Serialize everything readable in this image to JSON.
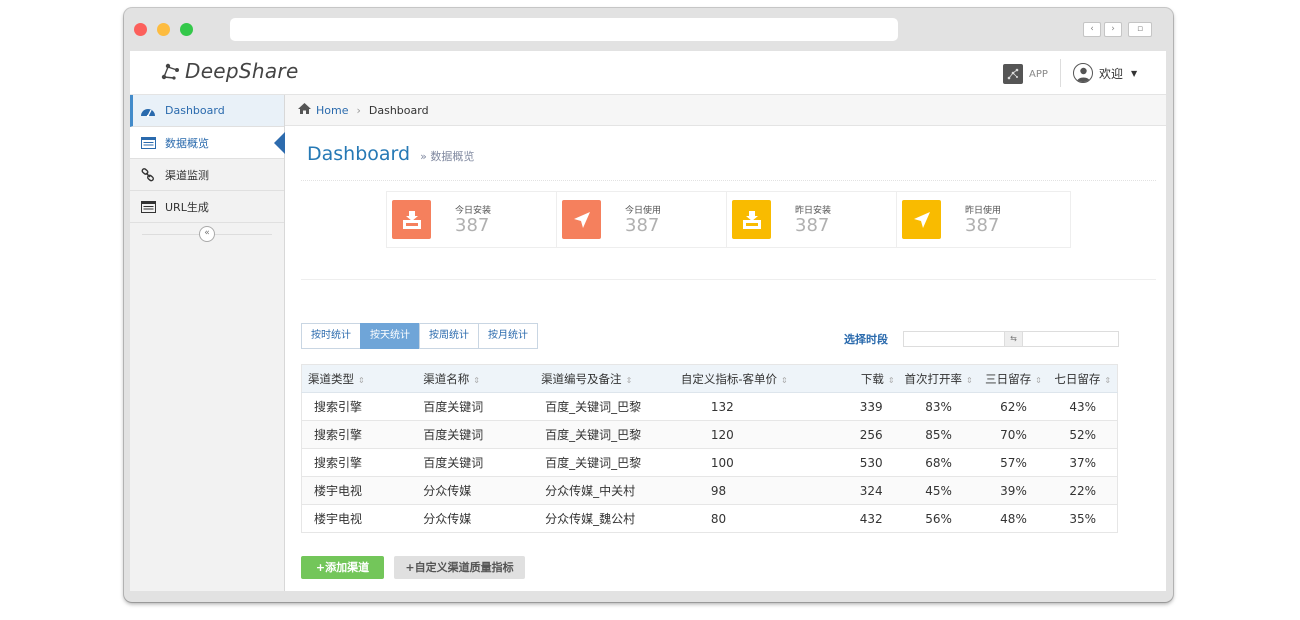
{
  "brand": {
    "name": "DeepShare"
  },
  "header": {
    "app_label": "APP",
    "welcome": "欢迎"
  },
  "sidebar": {
    "items": [
      {
        "label": "Dashboard",
        "icon": "dashboard-icon"
      },
      {
        "label": "数据概览",
        "icon": "list-icon"
      },
      {
        "label": "渠道监测",
        "icon": "link-icon"
      },
      {
        "label": "URL生成",
        "icon": "list-icon"
      }
    ],
    "collapse": "«"
  },
  "breadcrumb": {
    "home": "Home",
    "current": "Dashboard"
  },
  "page": {
    "title": "Dashboard",
    "subtitle": "» 数据概览"
  },
  "stats": [
    {
      "label": "今日安装",
      "value": "387",
      "color": "#f5805d",
      "icon": "download-icon"
    },
    {
      "label": "今日使用",
      "value": "387",
      "color": "#f5805d",
      "icon": "navigation-icon"
    },
    {
      "label": "昨日安装",
      "value": "387",
      "color": "#f9bb00",
      "icon": "download-icon"
    },
    {
      "label": "昨日使用",
      "value": "387",
      "color": "#f9bb00",
      "icon": "navigation-icon"
    }
  ],
  "tabs": [
    "按时统计",
    "按天统计",
    "按周统计",
    "按月统计"
  ],
  "date_range": {
    "label": "选择时段",
    "separator": "⇆"
  },
  "table": {
    "columns": [
      "渠道类型",
      "渠道名称",
      "渠道编号及备注",
      "自定义指标-客单价",
      "下载",
      "首次打开率",
      "三日留存",
      "七日留存"
    ],
    "rows": [
      [
        "搜索引擎",
        "百度关键词",
        "百度_关键词_巴黎",
        "132",
        "339",
        "83%",
        "62%",
        "43%"
      ],
      [
        "搜索引擎",
        "百度关键词",
        "百度_关键词_巴黎",
        "120",
        "256",
        "85%",
        "70%",
        "52%"
      ],
      [
        "搜索引擎",
        "百度关键词",
        "百度_关键词_巴黎",
        "100",
        "530",
        "68%",
        "57%",
        "37%"
      ],
      [
        "楼宇电视",
        "分众传媒",
        "分众传媒_中关村",
        "98",
        "324",
        "45%",
        "39%",
        "22%"
      ],
      [
        "楼宇电视",
        "分众传媒",
        "分众传媒_魏公村",
        "80",
        "432",
        "56%",
        "48%",
        "35%"
      ]
    ]
  },
  "buttons": {
    "add_channel": "+添加渠道",
    "custom_metric": "+自定义渠道质量指标"
  },
  "colors": {
    "accent": "#2679b5",
    "active_tab": "#6fa5d8",
    "add_button": "#73c65a"
  }
}
